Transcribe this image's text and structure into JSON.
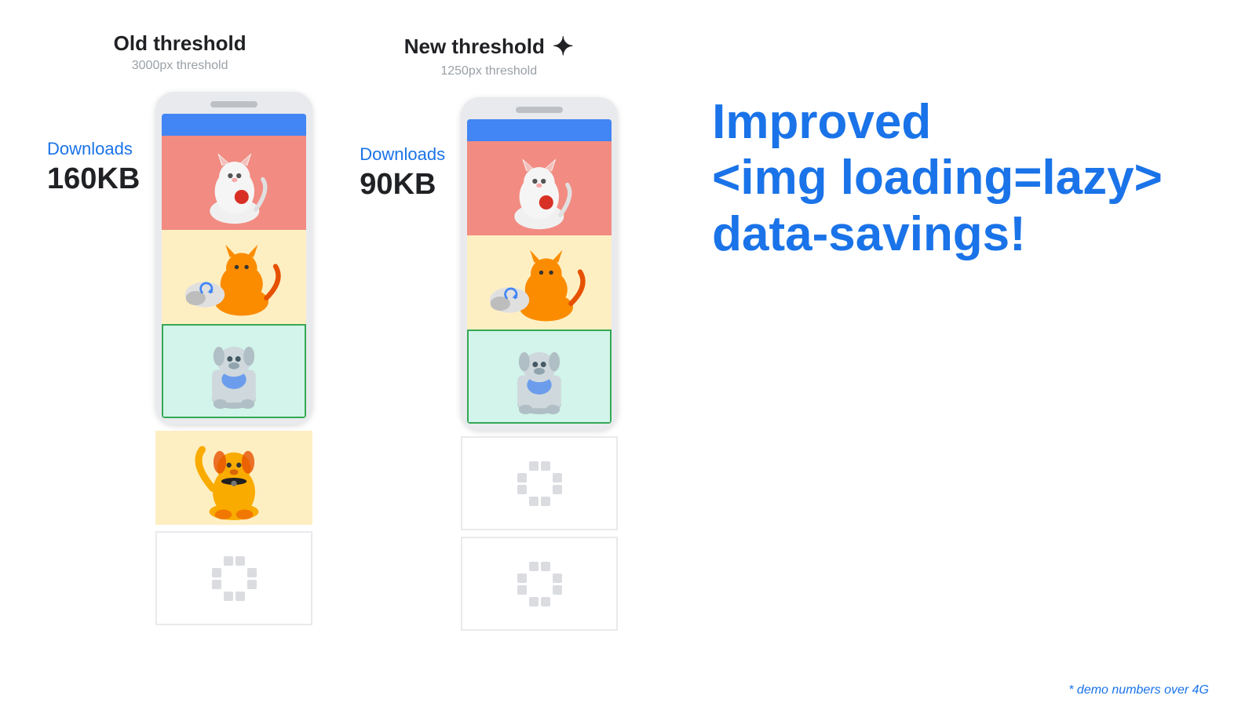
{
  "left": {
    "threshold_label": "Old threshold",
    "threshold_subtitle": "3000px threshold",
    "downloads_text": "Downloads",
    "downloads_size": "160KB"
  },
  "right": {
    "threshold_label": "New threshold",
    "threshold_subtitle": "1250px threshold",
    "sparkle": "✦",
    "downloads_text": "Downloads",
    "downloads_size": "90KB"
  },
  "hero": {
    "line1": "Improved",
    "line2": "<img loading=lazy>",
    "line3": "data-savings!"
  },
  "footer": {
    "demo_note": "* demo numbers over 4G"
  }
}
